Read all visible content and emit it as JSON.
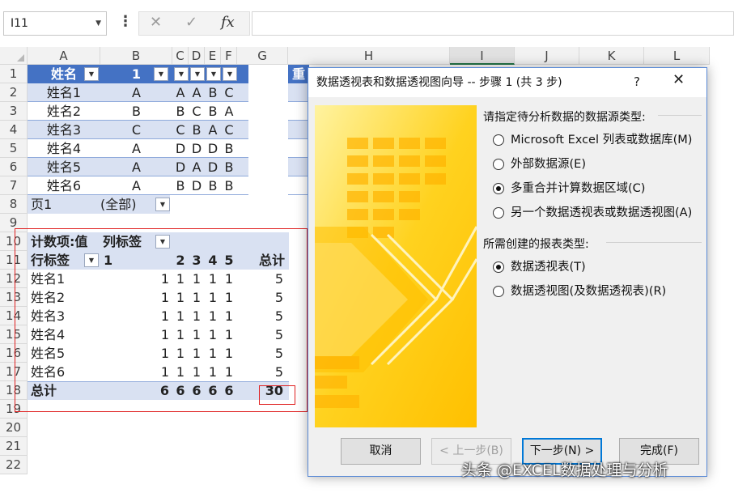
{
  "formula_bar": {
    "name_box": "I11",
    "fx": "fx"
  },
  "columns": [
    "A",
    "B",
    "C",
    "D",
    "E",
    "F",
    "G",
    "H",
    "I",
    "J",
    "K",
    "L"
  ],
  "rows": [
    "1",
    "2",
    "3",
    "4",
    "5",
    "6",
    "7",
    "8",
    "9",
    "10",
    "11",
    "12",
    "13",
    "14",
    "15",
    "16",
    "17",
    "18",
    "19",
    "20",
    "21",
    "22"
  ],
  "source_table": {
    "headers": [
      "姓名",
      "1",
      "",
      "",
      "",
      ""
    ],
    "rows": [
      [
        "姓名1",
        "A",
        "A",
        "A",
        "B",
        "C"
      ],
      [
        "姓名2",
        "B",
        "B",
        "C",
        "B",
        "A"
      ],
      [
        "姓名3",
        "C",
        "C",
        "B",
        "A",
        "C"
      ],
      [
        "姓名4",
        "A",
        "D",
        "D",
        "D",
        "B"
      ],
      [
        "姓名5",
        "A",
        "D",
        "A",
        "D",
        "B"
      ],
      [
        "姓名6",
        "A",
        "B",
        "D",
        "B",
        "B"
      ]
    ]
  },
  "page_filter": {
    "label": "页1",
    "value": "(全部)"
  },
  "pivot": {
    "value_label": "计数项:值",
    "col_label": "列标签",
    "row_label": "行标签",
    "col_headers": [
      "1",
      "2",
      "3",
      "4",
      "5",
      "总计"
    ],
    "rows": [
      {
        "name": "姓名1",
        "vals": [
          "1",
          "1",
          "1",
          "1",
          "1",
          "5"
        ]
      },
      {
        "name": "姓名2",
        "vals": [
          "1",
          "1",
          "1",
          "1",
          "1",
          "5"
        ]
      },
      {
        "name": "姓名3",
        "vals": [
          "1",
          "1",
          "1",
          "1",
          "1",
          "5"
        ]
      },
      {
        "name": "姓名4",
        "vals": [
          "1",
          "1",
          "1",
          "1",
          "1",
          "5"
        ]
      },
      {
        "name": "姓名5",
        "vals": [
          "1",
          "1",
          "1",
          "1",
          "1",
          "5"
        ]
      },
      {
        "name": "姓名6",
        "vals": [
          "1",
          "1",
          "1",
          "1",
          "1",
          "5"
        ]
      }
    ],
    "total_label": "总计",
    "totals": [
      "6",
      "6",
      "6",
      "6",
      "6",
      "30"
    ]
  },
  "h_partial": "重",
  "dialog": {
    "title": "数据透视表和数据透视图向导 -- 步骤 1 (共 3 步)",
    "help": "?",
    "close": "✕",
    "source_group": "请指定待分析数据的数据源类型:",
    "source_options": [
      {
        "label": "Microsoft Excel 列表或数据库(M)",
        "selected": false
      },
      {
        "label": "外部数据源(E)",
        "selected": false
      },
      {
        "label": "多重合并计算数据区域(C)",
        "selected": true
      },
      {
        "label": "另一个数据透视表或数据透视图(A)",
        "selected": false
      }
    ],
    "report_group": "所需创建的报表类型:",
    "report_options": [
      {
        "label": "数据透视表(T)",
        "selected": true
      },
      {
        "label": "数据透视图(及数据透视表)(R)",
        "selected": false
      }
    ],
    "buttons": {
      "cancel": "取消",
      "back": "< 上一步(B)",
      "next": "下一步(N) >",
      "finish": "完成(F)"
    }
  },
  "watermark": "头条 @EXCEL数据处理与分析",
  "colors": {
    "band": "#d9e1f2",
    "accent": "#0078d7",
    "highlight_box": "#e02020"
  }
}
